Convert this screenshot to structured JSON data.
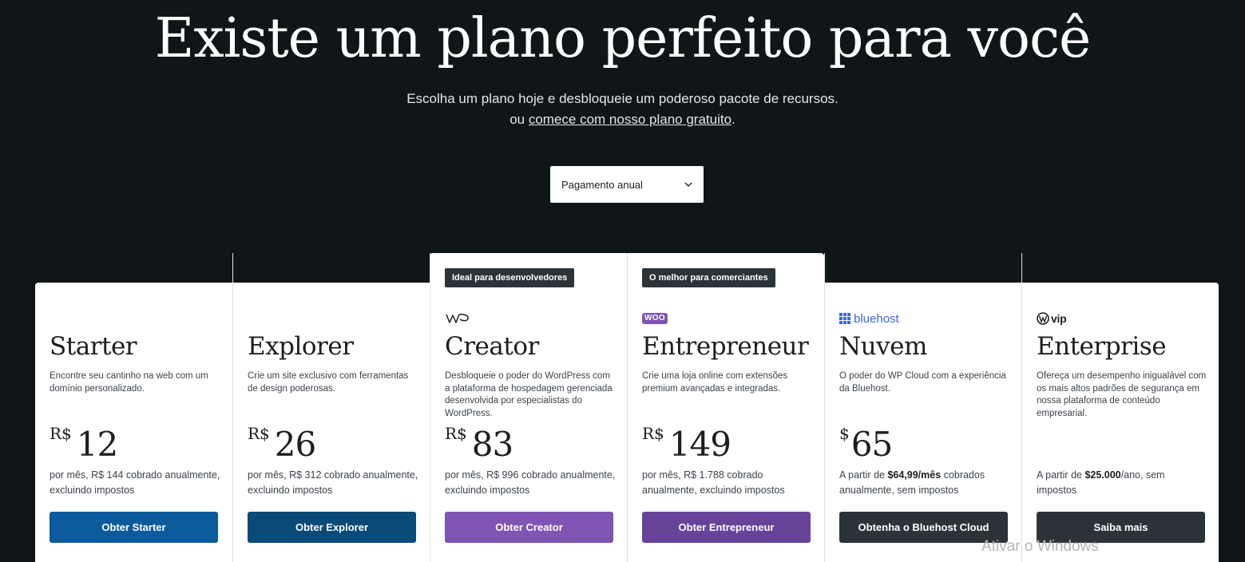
{
  "hero": {
    "title": "Existe um plano perfeito para você",
    "subtitle": "Escolha um plano hoje e desbloqueie um poderoso pacote de recursos.",
    "alt_prefix": "ou ",
    "alt_link": "comece com nosso plano gratuito",
    "alt_suffix": "."
  },
  "billing": {
    "selected": "Pagamento anual",
    "icon": "chevron-down-icon"
  },
  "plans": [
    {
      "name": "Starter",
      "desc": "Encontre seu cantinho na web com um domínio personalizado.",
      "currency": "R$",
      "amount": "12",
      "note": "por mês, R$ 144 cobrado anualmente, excluindo impostos",
      "cta": "Obter Starter",
      "cta_color": "#0b5a9c"
    },
    {
      "name": "Explorer",
      "desc": "Crie um site exclusivo com ferramentas de design poderosas.",
      "currency": "R$",
      "amount": "26",
      "note": "por mês, R$ 312 cobrado anualmente, excluindo impostos",
      "cta": "Obter Explorer",
      "cta_color": "#0a4a78"
    },
    {
      "badge": "Ideal para desenvolvedores",
      "logo_icon": "wp-cloud-logo-icon",
      "name": "Creator",
      "desc": "Desbloqueie o poder do WordPress com a plataforma de hospedagem gerenciada desenvolvida por especialistas do WordPress.",
      "currency": "R$",
      "amount": "83",
      "note": "por mês, R$ 996 cobrado anualmente, excluindo impostos",
      "cta": "Obter Creator",
      "cta_color": "#7f54b3"
    },
    {
      "badge": "O melhor para comerciantes",
      "logo_icon": "woo-logo-icon",
      "logo_text": "WOO",
      "name": "Entrepreneur",
      "desc": "Crie uma loja online com extensões premium avançadas e integradas.",
      "currency": "R$",
      "amount": "149",
      "note": "por mês, R$ 1.788 cobrado anualmente, excluindo impostos",
      "cta": "Obter Entrepreneur",
      "cta_color": "#674399"
    },
    {
      "logo_icon": "bluehost-logo-icon",
      "logo_text": "bluehost",
      "name": "Nuvem",
      "desc": "O poder do WP Cloud com a experiência da Bluehost.",
      "currency": "$",
      "amount": "65",
      "note_prefix": "A partir de ",
      "note_bold": "$64,99/mês",
      "note_suffix": " cobrados anualmente, sem impostos",
      "cta": "Obtenha o Bluehost Cloud",
      "cta_color": "#2c3338"
    },
    {
      "logo_icon": "wordpress-vip-logo-icon",
      "logo_text": "vip",
      "name": "Enterprise",
      "desc": "Ofereça um desempenho inigualável com os mais altos padrões de segurança em nossa plataforma de conteúdo empresarial.",
      "note_prefix": "A partir de ",
      "note_bold": "$25.000",
      "note_suffix": "/ano, sem impostos",
      "cta": "Saiba mais",
      "cta_color": "#2c3338"
    }
  ],
  "watermark": "Ativar o Windows"
}
